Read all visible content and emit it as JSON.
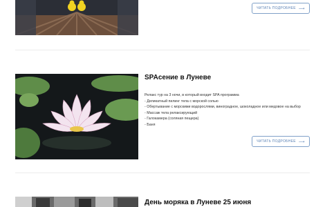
{
  "cards": [
    {
      "title": "",
      "button_label": "ЧИТАТЬ ПОДРОБНЕЕ",
      "button_arrow": "⟶"
    },
    {
      "title": "SPAсение в Луневе",
      "intro": "Релакс тур на 3 ночи, в который входит SPA программа",
      "items": [
        "- Деликатный пилинг тела с морской солью",
        "- Обертывание с морскими водорослями, виноградное, шоколадное или медовое на выбор",
        "- Массаж тела релаксирующий",
        "- Галокамера (соляная пещера)",
        "- Баня"
      ],
      "button_label": "ЧИТАТЬ ПОДРОБНЕЕ",
      "button_arrow": "⟶"
    },
    {
      "title": "День моряка в Луневе 25 июня"
    }
  ],
  "colors": {
    "accent": "#5b82b5",
    "divider": "#ececec"
  }
}
